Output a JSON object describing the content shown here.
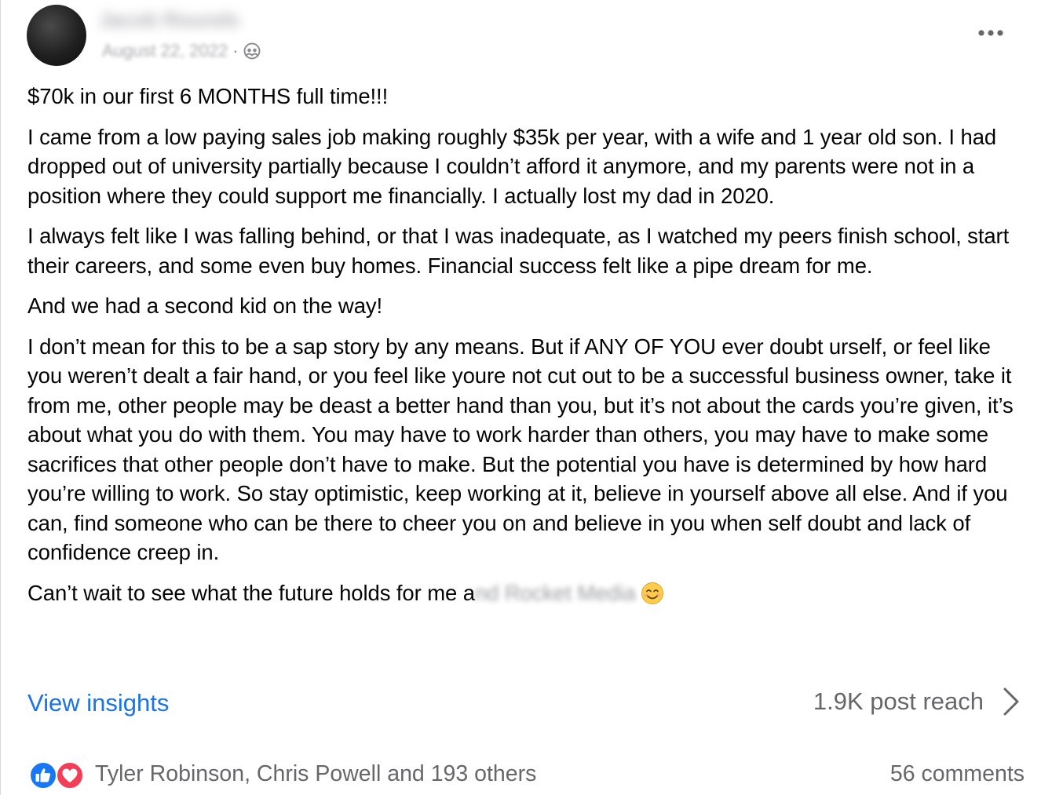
{
  "post": {
    "author_name": "Jacob Rounds",
    "date": "August 22, 2022",
    "separator": "·",
    "audience_icon": "group-members-icon",
    "more_icon": "more-dots-icon",
    "title": "$70k in our first 6 MONTHS full time!!!",
    "paragraphs": [
      "I came from a low paying sales job making roughly $35k per year, with a wife and 1 year old son. I had dropped out of university partially because I couldn’t afford it anymore, and my parents were not in a position where they could support me financially. I actually lost my dad in 2020.",
      "I always felt like I was falling behind, or that I was inadequate, as I watched my peers finish school, start their careers, and some even buy homes. Financial success felt like a pipe dream for me.",
      "And we had a second kid on the way!",
      "I don’t mean for this to be a sap story by any means. But if ANY OF YOU ever doubt urself, or feel like you weren’t dealt a fair hand, or you feel like youre not cut out to be a successful business owner, take it from me, other people may be deast a better hand than you, but it’s not about the cards you’re given, it’s about what you do with them. You may have to work harder than others, you may have to make some sacrifices that other people don’t have to make. But the potential you have is determined by how hard you’re willing to work. So stay optimistic, keep working at it, believe in yourself above all else. And if you can, find someone who can be there to cheer you on and believe in you when self doubt and lack of confidence creep in."
    ],
    "closing_prefix": "Can’t wait to see what the future holds for me a",
    "closing_blurred": "nd Rocket Media",
    "closing_emoji": "smiling-face-emoji"
  },
  "insights": {
    "view_label": "View insights",
    "reach_label": "1.9K post reach",
    "chevron_icon": "chevron-right-icon"
  },
  "reactions": {
    "icons": [
      "like-reaction-icon",
      "love-reaction-icon"
    ],
    "summary": "Tyler Robinson, Chris Powell and 193 others",
    "comments": "56 comments"
  },
  "colors": {
    "link_blue": "#1b74e4",
    "secondary_text": "#65676b",
    "like_blue": "#1877f2",
    "love_red": "#f33e58"
  }
}
